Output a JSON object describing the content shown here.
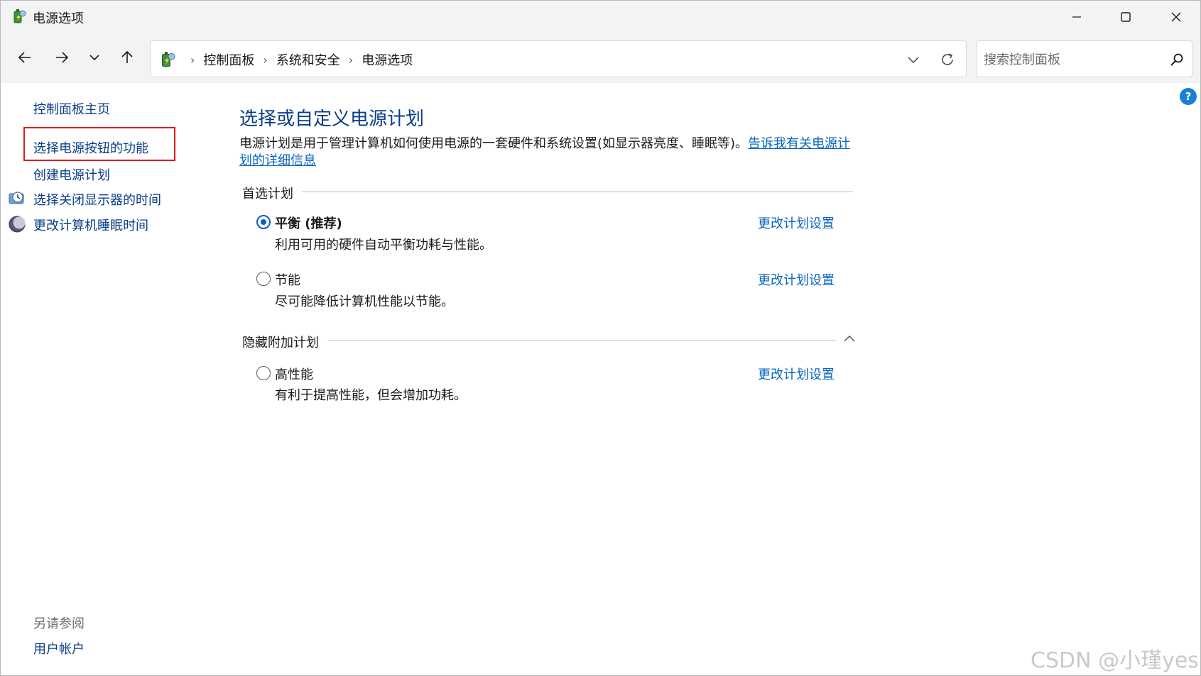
{
  "window": {
    "title": "电源选项",
    "icons": {
      "app": "power-battery-icon",
      "minimize": "minimize-icon",
      "maximize": "maximize-icon",
      "close": "close-icon"
    }
  },
  "nav": {
    "breadcrumbs": [
      "控制面板",
      "系统和安全",
      "电源选项"
    ],
    "search_placeholder": "搜索控制面板"
  },
  "sidebar": {
    "home": "控制面板主页",
    "power_button": "选择电源按钮的功能",
    "create_plan": "创建电源计划",
    "display_off": "选择关闭显示器的时间",
    "sleep": "更改计算机睡眠时间",
    "see_also": "另请参阅",
    "accounts": "用户帐户"
  },
  "main": {
    "title": "选择或自定义电源计划",
    "description": "电源计划是用于管理计算机如何使用电源的一套硬件和系统设置(如显示器亮度、睡眠等)。",
    "description_link_1": "告诉我有关电源计",
    "description_link_2": "划的详细信息",
    "preferred_header": "首选计划",
    "hidden_header": "隐藏附加计划",
    "change_link": "更改计划设置",
    "plans": [
      {
        "name": "平衡 (推荐)",
        "desc": "利用可用的硬件自动平衡功耗与性能。",
        "selected": true
      },
      {
        "name": "节能",
        "desc": "尽可能降低计算机性能以节能。",
        "selected": false
      },
      {
        "name": "高性能",
        "desc": "有利于提高性能，但会增加功耗。",
        "selected": false
      }
    ]
  },
  "watermark": "CSDN @小瑾yes",
  "colors": {
    "accent": "#0a5fc2",
    "link": "#0a66c2",
    "title": "#0a3d86",
    "highlight": "#e0191b"
  }
}
